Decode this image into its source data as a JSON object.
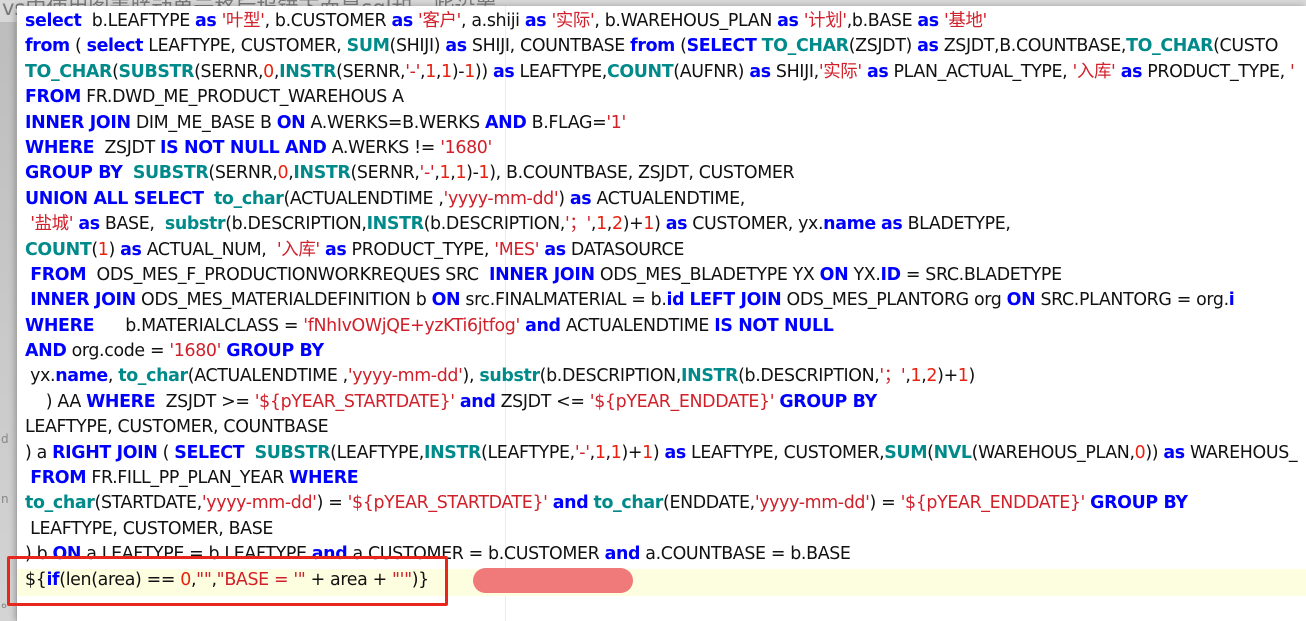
{
  "background_title": "vs中使用图表联动单元格后报错下面是sql和一些设置",
  "left_fragments": [
    "d",
    "n",
    "ه"
  ],
  "code_lines": [
    [
      {
        "t": "select",
        "c": "k"
      },
      {
        "t": "  b.LEAFTYPE ",
        "c": "p"
      },
      {
        "t": "as",
        "c": "k"
      },
      {
        "t": " ",
        "c": "p"
      },
      {
        "t": "'叶型'",
        "c": "s"
      },
      {
        "t": ", b.CUSTOMER ",
        "c": "p"
      },
      {
        "t": "as",
        "c": "k"
      },
      {
        "t": " ",
        "c": "p"
      },
      {
        "t": "'客户'",
        "c": "s"
      },
      {
        "t": ", a.shiji ",
        "c": "p"
      },
      {
        "t": "as",
        "c": "k"
      },
      {
        "t": " ",
        "c": "p"
      },
      {
        "t": "'实际'",
        "c": "s"
      },
      {
        "t": ", b.WAREHOUS_PLAN ",
        "c": "p"
      },
      {
        "t": "as",
        "c": "k"
      },
      {
        "t": " ",
        "c": "p"
      },
      {
        "t": "'计划'",
        "c": "s"
      },
      {
        "t": ",b.BASE ",
        "c": "p"
      },
      {
        "t": "as",
        "c": "k"
      },
      {
        "t": " ",
        "c": "p"
      },
      {
        "t": "'基地'",
        "c": "s"
      }
    ],
    [
      {
        "t": "from",
        "c": "k"
      },
      {
        "t": " ( ",
        "c": "p"
      },
      {
        "t": "select",
        "c": "k"
      },
      {
        "t": " LEAFTYPE, CUSTOMER, ",
        "c": "p"
      },
      {
        "t": "SUM",
        "c": "f"
      },
      {
        "t": "(SHIJI) ",
        "c": "p"
      },
      {
        "t": "as",
        "c": "k"
      },
      {
        "t": " SHIJI, COUNTBASE ",
        "c": "p"
      },
      {
        "t": "from",
        "c": "k"
      },
      {
        "t": " (",
        "c": "p"
      },
      {
        "t": "SELECT",
        "c": "k"
      },
      {
        "t": " ",
        "c": "p"
      },
      {
        "t": "TO_CHAR",
        "c": "f"
      },
      {
        "t": "(ZSJDT) ",
        "c": "p"
      },
      {
        "t": "as",
        "c": "k"
      },
      {
        "t": " ZSJDT,B.COUNTBASE,",
        "c": "p"
      },
      {
        "t": "TO_CHAR",
        "c": "f"
      },
      {
        "t": "(CUSTO",
        "c": "p"
      }
    ],
    [
      {
        "t": "TO_CHAR",
        "c": "f"
      },
      {
        "t": "(",
        "c": "p"
      },
      {
        "t": "SUBSTR",
        "c": "f"
      },
      {
        "t": "(SERNR,",
        "c": "p"
      },
      {
        "t": "0",
        "c": "n"
      },
      {
        "t": ",",
        "c": "p"
      },
      {
        "t": "INSTR",
        "c": "f"
      },
      {
        "t": "(SERNR,",
        "c": "p"
      },
      {
        "t": "'-'",
        "c": "s"
      },
      {
        "t": ",",
        "c": "p"
      },
      {
        "t": "1",
        "c": "n"
      },
      {
        "t": ",",
        "c": "p"
      },
      {
        "t": "1",
        "c": "n"
      },
      {
        "t": ")-",
        "c": "p"
      },
      {
        "t": "1",
        "c": "n"
      },
      {
        "t": ")) ",
        "c": "p"
      },
      {
        "t": "as",
        "c": "k"
      },
      {
        "t": " LEAFTYPE,",
        "c": "p"
      },
      {
        "t": "COUNT",
        "c": "f"
      },
      {
        "t": "(AUFNR) ",
        "c": "p"
      },
      {
        "t": "as",
        "c": "k"
      },
      {
        "t": " SHIJI,",
        "c": "p"
      },
      {
        "t": "'实际'",
        "c": "s"
      },
      {
        "t": " ",
        "c": "p"
      },
      {
        "t": "as",
        "c": "k"
      },
      {
        "t": " PLAN_ACTUAL_TYPE, ",
        "c": "p"
      },
      {
        "t": "'入库'",
        "c": "s"
      },
      {
        "t": " ",
        "c": "p"
      },
      {
        "t": "as",
        "c": "k"
      },
      {
        "t": " PRODUCT_TYPE, ",
        "c": "p"
      },
      {
        "t": "'",
        "c": "s"
      }
    ],
    [
      {
        "t": "FROM",
        "c": "k"
      },
      {
        "t": " FR.DWD_ME_PRODUCT_WAREHOUS A",
        "c": "p"
      }
    ],
    [
      {
        "t": "INNER JOIN",
        "c": "k"
      },
      {
        "t": " DIM_ME_BASE B ",
        "c": "p"
      },
      {
        "t": "ON",
        "c": "k"
      },
      {
        "t": " A.WERKS=B.WERKS ",
        "c": "p"
      },
      {
        "t": "AND",
        "c": "k"
      },
      {
        "t": " B.FLAG=",
        "c": "p"
      },
      {
        "t": "'1'",
        "c": "s"
      }
    ],
    [
      {
        "t": "WHERE",
        "c": "k"
      },
      {
        "t": "  ZSJDT ",
        "c": "p"
      },
      {
        "t": "IS NOT NULL AND",
        "c": "k"
      },
      {
        "t": " A.WERKS != ",
        "c": "p"
      },
      {
        "t": "'1680'",
        "c": "s"
      }
    ],
    [
      {
        "t": "GROUP BY",
        "c": "k"
      },
      {
        "t": "  ",
        "c": "p"
      },
      {
        "t": "SUBSTR",
        "c": "f"
      },
      {
        "t": "(SERNR,",
        "c": "p"
      },
      {
        "t": "0",
        "c": "n"
      },
      {
        "t": ",",
        "c": "p"
      },
      {
        "t": "INSTR",
        "c": "f"
      },
      {
        "t": "(SERNR,",
        "c": "p"
      },
      {
        "t": "'-'",
        "c": "s"
      },
      {
        "t": ",",
        "c": "p"
      },
      {
        "t": "1",
        "c": "n"
      },
      {
        "t": ",",
        "c": "p"
      },
      {
        "t": "1",
        "c": "n"
      },
      {
        "t": ")-",
        "c": "p"
      },
      {
        "t": "1",
        "c": "n"
      },
      {
        "t": "), B.COUNTBASE, ZSJDT, CUSTOMER",
        "c": "p"
      }
    ],
    [
      {
        "t": "UNION ALL SELECT",
        "c": "k"
      },
      {
        "t": "  ",
        "c": "p"
      },
      {
        "t": "to_char",
        "c": "f"
      },
      {
        "t": "(ACTUALENDTIME ,",
        "c": "p"
      },
      {
        "t": "'yyyy-mm-dd'",
        "c": "s"
      },
      {
        "t": ") ",
        "c": "p"
      },
      {
        "t": "as",
        "c": "k"
      },
      {
        "t": " ACTUALENDTIME,",
        "c": "p"
      }
    ],
    [
      {
        "t": " ",
        "c": "p"
      },
      {
        "t": "'盐城'",
        "c": "s"
      },
      {
        "t": " ",
        "c": "p"
      },
      {
        "t": "as",
        "c": "k"
      },
      {
        "t": " BASE,  ",
        "c": "p"
      },
      {
        "t": "substr",
        "c": "f"
      },
      {
        "t": "(b.DESCRIPTION,",
        "c": "p"
      },
      {
        "t": "INSTR",
        "c": "f"
      },
      {
        "t": "(b.DESCRIPTION,",
        "c": "p"
      },
      {
        "t": "'；'",
        "c": "s"
      },
      {
        "t": ",",
        "c": "p"
      },
      {
        "t": "1",
        "c": "n"
      },
      {
        "t": ",",
        "c": "p"
      },
      {
        "t": "2",
        "c": "n"
      },
      {
        "t": ")+",
        "c": "p"
      },
      {
        "t": "1",
        "c": "n"
      },
      {
        "t": ") ",
        "c": "p"
      },
      {
        "t": "as",
        "c": "k"
      },
      {
        "t": " CUSTOMER, yx.",
        "c": "p"
      },
      {
        "t": "name",
        "c": "k"
      },
      {
        "t": " ",
        "c": "p"
      },
      {
        "t": "as",
        "c": "k"
      },
      {
        "t": " BLADETYPE,",
        "c": "p"
      }
    ],
    [
      {
        "t": "COUNT",
        "c": "f"
      },
      {
        "t": "(",
        "c": "p"
      },
      {
        "t": "1",
        "c": "n"
      },
      {
        "t": ") ",
        "c": "p"
      },
      {
        "t": "as",
        "c": "k"
      },
      {
        "t": " ACTUAL_NUM,  ",
        "c": "p"
      },
      {
        "t": "'入库'",
        "c": "s"
      },
      {
        "t": " ",
        "c": "p"
      },
      {
        "t": "as",
        "c": "k"
      },
      {
        "t": " PRODUCT_TYPE, ",
        "c": "p"
      },
      {
        "t": "'MES'",
        "c": "s"
      },
      {
        "t": " ",
        "c": "p"
      },
      {
        "t": "as",
        "c": "k"
      },
      {
        "t": " DATASOURCE",
        "c": "p"
      }
    ],
    [
      {
        "t": " ",
        "c": "p"
      },
      {
        "t": "FROM",
        "c": "k"
      },
      {
        "t": "  ODS_MES_F_PRODUCTIONWORKREQUES SRC  ",
        "c": "p"
      },
      {
        "t": "INNER JOIN",
        "c": "k"
      },
      {
        "t": " ODS_MES_BLADETYPE YX ",
        "c": "p"
      },
      {
        "t": "ON",
        "c": "k"
      },
      {
        "t": " YX.",
        "c": "p"
      },
      {
        "t": "ID",
        "c": "k"
      },
      {
        "t": " = SRC.BLADETYPE",
        "c": "p"
      }
    ],
    [
      {
        "t": " ",
        "c": "p"
      },
      {
        "t": "INNER JOIN",
        "c": "k"
      },
      {
        "t": " ODS_MES_MATERIALDEFINITION b ",
        "c": "p"
      },
      {
        "t": "ON",
        "c": "k"
      },
      {
        "t": " src.FINALMATERIAL = b.",
        "c": "p"
      },
      {
        "t": "id",
        "c": "k"
      },
      {
        "t": " ",
        "c": "p"
      },
      {
        "t": "LEFT JOIN",
        "c": "k"
      },
      {
        "t": " ODS_MES_PLANTORG org ",
        "c": "p"
      },
      {
        "t": "ON",
        "c": "k"
      },
      {
        "t": " SRC.PLANTORG = org.",
        "c": "p"
      },
      {
        "t": "i",
        "c": "k"
      }
    ],
    [
      {
        "t": "WHERE",
        "c": "k"
      },
      {
        "t": "      b.MATERIALCLASS = ",
        "c": "p"
      },
      {
        "t": "'fNhIvOWjQE+yzKTi6jtfog'",
        "c": "s"
      },
      {
        "t": " ",
        "c": "p"
      },
      {
        "t": "and",
        "c": "k"
      },
      {
        "t": " ACTUALENDTIME ",
        "c": "p"
      },
      {
        "t": "IS NOT NULL",
        "c": "k"
      }
    ],
    [
      {
        "t": "AND",
        "c": "k"
      },
      {
        "t": " org.code = ",
        "c": "p"
      },
      {
        "t": "'1680'",
        "c": "s"
      },
      {
        "t": " ",
        "c": "p"
      },
      {
        "t": "GROUP BY",
        "c": "k"
      }
    ],
    [
      {
        "t": " yx.",
        "c": "p"
      },
      {
        "t": "name",
        "c": "k"
      },
      {
        "t": ", ",
        "c": "p"
      },
      {
        "t": "to_char",
        "c": "f"
      },
      {
        "t": "(ACTUALENDTIME ,",
        "c": "p"
      },
      {
        "t": "'yyyy-mm-dd'",
        "c": "s"
      },
      {
        "t": "), ",
        "c": "p"
      },
      {
        "t": "substr",
        "c": "f"
      },
      {
        "t": "(b.DESCRIPTION,",
        "c": "p"
      },
      {
        "t": "INSTR",
        "c": "f"
      },
      {
        "t": "(b.DESCRIPTION,",
        "c": "p"
      },
      {
        "t": "'；'",
        "c": "s"
      },
      {
        "t": ",",
        "c": "p"
      },
      {
        "t": "1",
        "c": "n"
      },
      {
        "t": ",",
        "c": "p"
      },
      {
        "t": "2",
        "c": "n"
      },
      {
        "t": ")+",
        "c": "p"
      },
      {
        "t": "1",
        "c": "n"
      },
      {
        "t": ")",
        "c": "p"
      }
    ],
    [
      {
        "t": "    ) AA ",
        "c": "p"
      },
      {
        "t": "WHERE",
        "c": "k"
      },
      {
        "t": "  ZSJDT >= ",
        "c": "p"
      },
      {
        "t": "'${pYEAR_STARTDATE}'",
        "c": "s"
      },
      {
        "t": " ",
        "c": "p"
      },
      {
        "t": "and",
        "c": "k"
      },
      {
        "t": " ZSJDT <= ",
        "c": "p"
      },
      {
        "t": "'${pYEAR_ENDDATE}'",
        "c": "s"
      },
      {
        "t": " ",
        "c": "p"
      },
      {
        "t": "GROUP BY",
        "c": "k"
      }
    ],
    [
      {
        "t": "LEAFTYPE, CUSTOMER, COUNTBASE",
        "c": "p"
      }
    ],
    [
      {
        "t": ") a ",
        "c": "p"
      },
      {
        "t": "RIGHT JOIN",
        "c": "k"
      },
      {
        "t": " ( ",
        "c": "p"
      },
      {
        "t": "SELECT",
        "c": "k"
      },
      {
        "t": "  ",
        "c": "p"
      },
      {
        "t": "SUBSTR",
        "c": "f"
      },
      {
        "t": "(LEAFTYPE,",
        "c": "p"
      },
      {
        "t": "INSTR",
        "c": "f"
      },
      {
        "t": "(LEAFTYPE,",
        "c": "p"
      },
      {
        "t": "'-'",
        "c": "s"
      },
      {
        "t": ",",
        "c": "p"
      },
      {
        "t": "1",
        "c": "n"
      },
      {
        "t": ",",
        "c": "p"
      },
      {
        "t": "1",
        "c": "n"
      },
      {
        "t": ")+",
        "c": "p"
      },
      {
        "t": "1",
        "c": "n"
      },
      {
        "t": ") ",
        "c": "p"
      },
      {
        "t": "as",
        "c": "k"
      },
      {
        "t": " LEAFTYPE, CUSTOMER,",
        "c": "p"
      },
      {
        "t": "SUM",
        "c": "f"
      },
      {
        "t": "(",
        "c": "p"
      },
      {
        "t": "NVL",
        "c": "f"
      },
      {
        "t": "(WAREHOUS_PLAN,",
        "c": "p"
      },
      {
        "t": "0",
        "c": "n"
      },
      {
        "t": ")) ",
        "c": "p"
      },
      {
        "t": "as",
        "c": "k"
      },
      {
        "t": " WAREHOUS_",
        "c": "p"
      }
    ],
    [
      {
        "t": " ",
        "c": "p"
      },
      {
        "t": "FROM",
        "c": "k"
      },
      {
        "t": " FR.FILL_PP_PLAN_YEAR ",
        "c": "p"
      },
      {
        "t": "WHERE",
        "c": "k"
      }
    ],
    [
      {
        "t": "to_char",
        "c": "f"
      },
      {
        "t": "(STARTDATE,",
        "c": "p"
      },
      {
        "t": "'yyyy-mm-dd'",
        "c": "s"
      },
      {
        "t": ") = ",
        "c": "p"
      },
      {
        "t": "'${pYEAR_STARTDATE}'",
        "c": "s"
      },
      {
        "t": " ",
        "c": "p"
      },
      {
        "t": "and",
        "c": "k"
      },
      {
        "t": " ",
        "c": "p"
      },
      {
        "t": "to_char",
        "c": "f"
      },
      {
        "t": "(ENDDATE,",
        "c": "p"
      },
      {
        "t": "'yyyy-mm-dd'",
        "c": "s"
      },
      {
        "t": ") = ",
        "c": "p"
      },
      {
        "t": "'${pYEAR_ENDDATE}'",
        "c": "s"
      },
      {
        "t": " ",
        "c": "p"
      },
      {
        "t": "GROUP BY",
        "c": "k"
      }
    ],
    [
      {
        "t": " LEAFTYPE, CUSTOMER, BASE",
        "c": "p"
      }
    ],
    [
      {
        "t": ") b ",
        "c": "p"
      },
      {
        "t": "ON",
        "c": "k"
      },
      {
        "t": " a.LEAFTYPE = b.LEAFTYPE ",
        "c": "p"
      },
      {
        "t": "and",
        "c": "k"
      },
      {
        "t": " a.CUSTOMER = b.CUSTOMER ",
        "c": "p"
      },
      {
        "t": "and",
        "c": "k"
      },
      {
        "t": " a.COUNTBASE = b.BASE",
        "c": "p"
      }
    ],
    [
      {
        "t": "${",
        "c": "p"
      },
      {
        "t": "if",
        "c": "k"
      },
      {
        "t": "(len(area) == ",
        "c": "p"
      },
      {
        "t": "0",
        "c": "n"
      },
      {
        "t": ",",
        "c": "p"
      },
      {
        "t": "\"\"",
        "c": "s"
      },
      {
        "t": ",",
        "c": "p"
      },
      {
        "t": "\"BASE = '\"",
        "c": "s"
      },
      {
        "t": " + area + ",
        "c": "p"
      },
      {
        "t": "\"'\"",
        "c": "s"
      },
      {
        "t": ")}",
        "c": "p"
      }
    ]
  ],
  "colors": {
    "keyword": "#0000ff",
    "function": "#008a8a",
    "string": "#d0202a",
    "number": "#e8210f",
    "highlight_box": "#e8261b",
    "redaction": "#f07979"
  }
}
